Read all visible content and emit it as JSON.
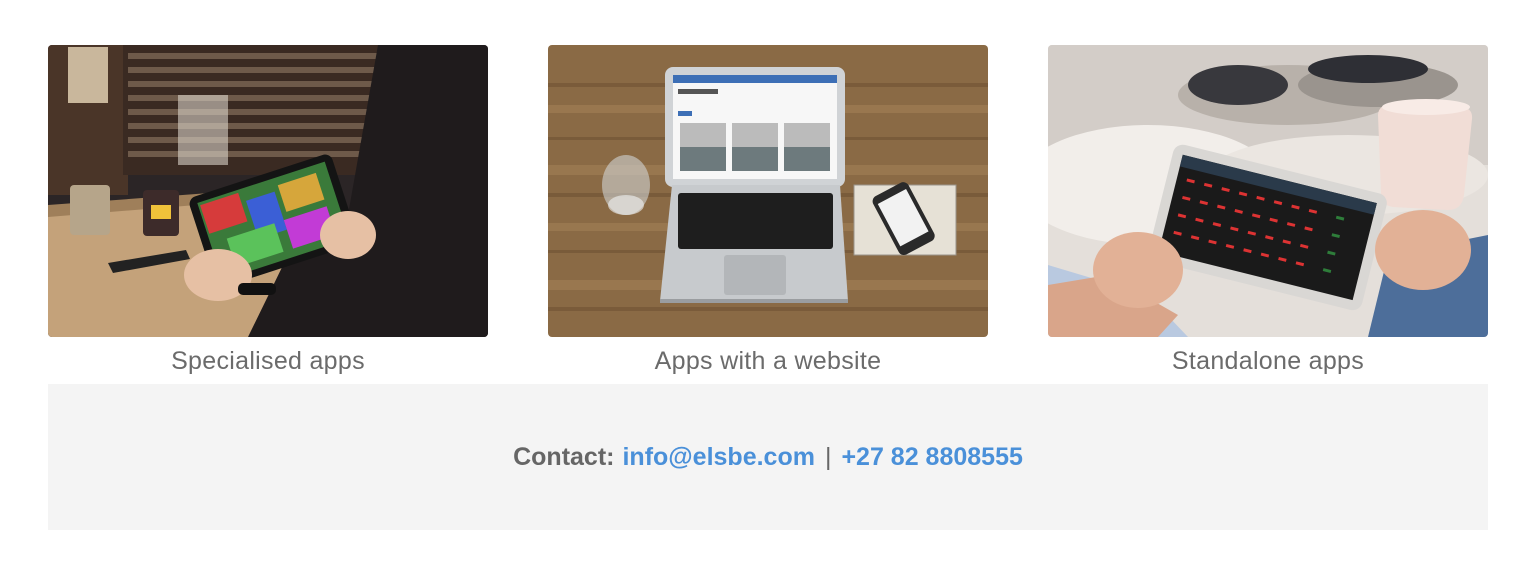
{
  "cards": [
    {
      "caption": "Specialised apps",
      "image": "tablet-restaurant-photo"
    },
    {
      "caption": "Apps with a website",
      "image": "laptop-desk-photo"
    },
    {
      "caption": "Standalone apps",
      "image": "tablet-scanner-photo"
    }
  ],
  "contact": {
    "label": "Contact:",
    "email": "info@elsbe.com",
    "separator": "|",
    "phone": "+27 82 8808555"
  },
  "colors": {
    "link": "#4a90d9",
    "caption_text": "#6b6b6b",
    "contact_background": "#f4f4f4"
  }
}
